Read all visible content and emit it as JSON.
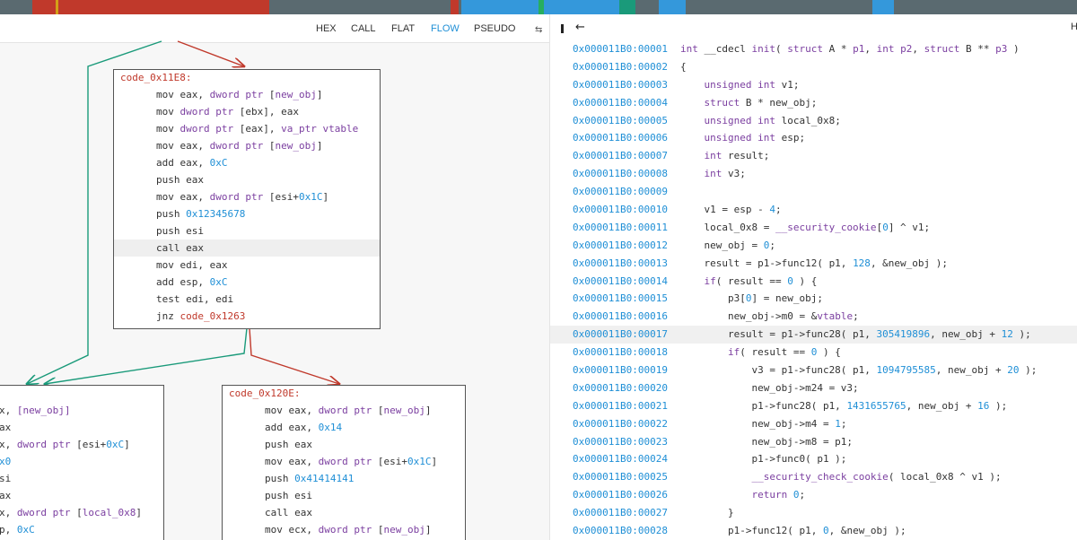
{
  "colors": {
    "accent": "#1f8fd6",
    "false_edge": "#c0392b",
    "true_edge": "#1a9a7a",
    "keyword": "#7b3fa0"
  },
  "navband": [
    {
      "color": "#c0392b",
      "start": 0.03,
      "end": 0.25
    },
    {
      "color": "#d4a017",
      "start": 0.052,
      "end": 0.054
    },
    {
      "color": "#c0392b",
      "start": 0.418,
      "end": 0.426
    },
    {
      "color": "#3498db",
      "start": 0.428,
      "end": 0.5
    },
    {
      "color": "#27ae60",
      "start": 0.5,
      "end": 0.505
    },
    {
      "color": "#3498db",
      "start": 0.505,
      "end": 0.575
    },
    {
      "color": "#1a9a7a",
      "start": 0.575,
      "end": 0.59
    },
    {
      "color": "#3498db",
      "start": 0.612,
      "end": 0.637
    },
    {
      "color": "#3498db",
      "start": 0.81,
      "end": 0.83
    }
  ],
  "tabs": [
    {
      "label": "HEX",
      "active": false
    },
    {
      "label": "CALL",
      "active": false
    },
    {
      "label": "FLAT",
      "active": false
    },
    {
      "label": "FLOW",
      "active": true
    },
    {
      "label": "PSEUDO",
      "active": false
    }
  ],
  "icons": {
    "swap": "swap-icon",
    "pin": "pin-icon",
    "back": "back-arrow-icon"
  },
  "right_toolbar": {
    "h_label": "H"
  },
  "nodes": {
    "main": {
      "title": "code_0x11E8:",
      "lines": [
        [
          [
            "kw",
            "mov eax, "
          ],
          [
            "pu",
            "dword ptr"
          ],
          [
            "kw",
            " ["
          ],
          [
            "pu",
            "new_obj"
          ],
          [
            "kw",
            "]"
          ]
        ],
        [
          [
            "kw",
            "mov "
          ],
          [
            "pu",
            "dword ptr"
          ],
          [
            "kw",
            " [ebx], eax"
          ]
        ],
        [
          [
            "kw",
            "mov "
          ],
          [
            "pu",
            "dword ptr"
          ],
          [
            "kw",
            " [eax], "
          ],
          [
            "pu",
            "va_ptr vtable"
          ]
        ],
        [
          [
            "kw",
            "mov eax, "
          ],
          [
            "pu",
            "dword ptr"
          ],
          [
            "kw",
            " ["
          ],
          [
            "pu",
            "new_obj"
          ],
          [
            "kw",
            "]"
          ]
        ],
        [
          [
            "kw",
            "add eax, "
          ],
          [
            "bl",
            "0xC"
          ]
        ],
        [
          [
            "kw",
            "push eax"
          ]
        ],
        [
          [
            "kw",
            "mov eax, "
          ],
          [
            "pu",
            "dword ptr"
          ],
          [
            "kw",
            " [esi+"
          ],
          [
            "bl",
            "0x1C"
          ],
          [
            "kw",
            "]"
          ]
        ],
        [
          [
            "kw",
            "push "
          ],
          [
            "bl",
            "0x12345678"
          ]
        ],
        [
          [
            "kw",
            "push esi"
          ]
        ],
        [
          [
            "kw",
            "call eax"
          ]
        ],
        [
          [
            "kw",
            "mov edi, eax"
          ]
        ],
        [
          [
            "kw",
            "add esp, "
          ],
          [
            "bl",
            "0xC"
          ]
        ],
        [
          [
            "kw",
            "test edi, edi"
          ]
        ],
        [
          [
            "kw",
            "jnz "
          ],
          [
            "rd",
            "code_0x1263"
          ]
        ]
      ]
    },
    "left": {
      "title": "",
      "lines": [
        [
          [
            "kw",
            "x, "
          ],
          [
            "pu",
            "[new_obj]"
          ]
        ],
        [
          [
            "kw",
            "ax"
          ]
        ],
        [
          [
            "kw",
            "x, "
          ],
          [
            "pu",
            "dword ptr"
          ],
          [
            "kw",
            " [esi+"
          ],
          [
            "bl",
            "0xC"
          ],
          [
            "kw",
            "]"
          ]
        ],
        [
          [
            "bl",
            "x0"
          ]
        ],
        [
          [
            "kw",
            "si"
          ]
        ],
        [
          [
            "kw",
            "ax"
          ]
        ],
        [
          [
            "kw",
            "x, "
          ],
          [
            "pu",
            "dword ptr"
          ],
          [
            "kw",
            " ["
          ],
          [
            "pu",
            "local_0x8"
          ],
          [
            "kw",
            "]"
          ]
        ],
        [
          [
            "kw",
            "p, "
          ],
          [
            "bl",
            "0xC"
          ]
        ]
      ]
    },
    "right": {
      "title": "code_0x120E:",
      "lines": [
        [
          [
            "kw",
            "mov eax, "
          ],
          [
            "pu",
            "dword ptr"
          ],
          [
            "kw",
            " ["
          ],
          [
            "pu",
            "new_obj"
          ],
          [
            "kw",
            "]"
          ]
        ],
        [
          [
            "kw",
            "add eax, "
          ],
          [
            "bl",
            "0x14"
          ]
        ],
        [
          [
            "kw",
            "push eax"
          ]
        ],
        [
          [
            "kw",
            "mov eax, "
          ],
          [
            "pu",
            "dword ptr"
          ],
          [
            "kw",
            " [esi+"
          ],
          [
            "bl",
            "0x1C"
          ],
          [
            "kw",
            "]"
          ]
        ],
        [
          [
            "kw",
            "push "
          ],
          [
            "bl",
            "0x41414141"
          ]
        ],
        [
          [
            "kw",
            "push esi"
          ]
        ],
        [
          [
            "kw",
            "call eax"
          ]
        ],
        [
          [
            "kw",
            "mov ecx, "
          ],
          [
            "pu",
            "dword ptr"
          ],
          [
            "kw",
            " ["
          ],
          [
            "pu",
            "new_obj"
          ],
          [
            "kw",
            "]"
          ]
        ]
      ]
    }
  },
  "pseudo": {
    "lines": [
      {
        "addr": "0x000011B0:00001",
        "code": [
          [
            "n",
            ""
          ],
          [
            "t",
            "int"
          ],
          [
            "x",
            " __cdecl "
          ],
          [
            "t",
            "init"
          ],
          [
            "x",
            "( "
          ],
          [
            "t",
            "struct"
          ],
          [
            "x",
            " A * "
          ],
          [
            "t",
            "p1"
          ],
          [
            "x",
            ", "
          ],
          [
            "t",
            "int"
          ],
          [
            "x",
            " "
          ],
          [
            "t",
            "p2"
          ],
          [
            "x",
            ", "
          ],
          [
            "t",
            "struct"
          ],
          [
            "x",
            " B ** "
          ],
          [
            "t",
            "p3"
          ],
          [
            "x",
            " )"
          ]
        ]
      },
      {
        "addr": "0x000011B0:00002",
        "code": [
          [
            "x",
            "{"
          ]
        ]
      },
      {
        "addr": "0x000011B0:00003",
        "code": [
          [
            "x",
            "    "
          ],
          [
            "t",
            "unsigned int"
          ],
          [
            "x",
            " v1;"
          ]
        ]
      },
      {
        "addr": "0x000011B0:00004",
        "code": [
          [
            "x",
            "    "
          ],
          [
            "t",
            "struct"
          ],
          [
            "x",
            " B * new_obj;"
          ]
        ]
      },
      {
        "addr": "0x000011B0:00005",
        "code": [
          [
            "x",
            "    "
          ],
          [
            "t",
            "unsigned int"
          ],
          [
            "x",
            " local_0x8;"
          ]
        ]
      },
      {
        "addr": "0x000011B0:00006",
        "code": [
          [
            "x",
            "    "
          ],
          [
            "t",
            "unsigned int"
          ],
          [
            "x",
            " esp;"
          ]
        ]
      },
      {
        "addr": "0x000011B0:00007",
        "code": [
          [
            "x",
            "    "
          ],
          [
            "t",
            "int"
          ],
          [
            "x",
            " result;"
          ]
        ]
      },
      {
        "addr": "0x000011B0:00008",
        "code": [
          [
            "x",
            "    "
          ],
          [
            "t",
            "int"
          ],
          [
            "x",
            " v3;"
          ]
        ]
      },
      {
        "addr": "0x000011B0:00009",
        "code": [
          [
            "x",
            ""
          ]
        ]
      },
      {
        "addr": "0x000011B0:00010",
        "code": [
          [
            "x",
            "    v1 = esp - "
          ],
          [
            "n",
            "4"
          ],
          [
            "x",
            ";"
          ]
        ]
      },
      {
        "addr": "0x000011B0:00011",
        "code": [
          [
            "x",
            "    local_0x8 = "
          ],
          [
            "t",
            "__security_cookie"
          ],
          [
            "x",
            "["
          ],
          [
            "n",
            "0"
          ],
          [
            "x",
            "] ^ v1;"
          ]
        ]
      },
      {
        "addr": "0x000011B0:00012",
        "code": [
          [
            "x",
            "    new_obj = "
          ],
          [
            "n",
            "0"
          ],
          [
            "x",
            ";"
          ]
        ]
      },
      {
        "addr": "0x000011B0:00013",
        "code": [
          [
            "x",
            "    result = p1->func12( p1, "
          ],
          [
            "n",
            "128"
          ],
          [
            "x",
            ", &new_obj );"
          ]
        ]
      },
      {
        "addr": "0x000011B0:00014",
        "code": [
          [
            "x",
            "    "
          ],
          [
            "t",
            "if"
          ],
          [
            "x",
            "( result == "
          ],
          [
            "n",
            "0"
          ],
          [
            "x",
            " ) {"
          ]
        ]
      },
      {
        "addr": "0x000011B0:00015",
        "code": [
          [
            "x",
            "        p3["
          ],
          [
            "n",
            "0"
          ],
          [
            "x",
            "] = new_obj;"
          ]
        ]
      },
      {
        "addr": "0x000011B0:00016",
        "code": [
          [
            "x",
            "        new_obj->m0 = &"
          ],
          [
            "t",
            "vtable"
          ],
          [
            "x",
            ";"
          ]
        ]
      },
      {
        "addr": "0x000011B0:00017",
        "code": [
          [
            "x",
            "        result = p1->func28( p1, "
          ],
          [
            "n",
            "305419896"
          ],
          [
            "x",
            ", new_obj + "
          ],
          [
            "n",
            "12"
          ],
          [
            "x",
            " );"
          ]
        ],
        "hl": true
      },
      {
        "addr": "0x000011B0:00018",
        "code": [
          [
            "x",
            "        "
          ],
          [
            "t",
            "if"
          ],
          [
            "x",
            "( result == "
          ],
          [
            "n",
            "0"
          ],
          [
            "x",
            " ) {"
          ]
        ]
      },
      {
        "addr": "0x000011B0:00019",
        "code": [
          [
            "x",
            "            v3 = p1->func28( p1, "
          ],
          [
            "n",
            "1094795585"
          ],
          [
            "x",
            ", new_obj + "
          ],
          [
            "n",
            "20"
          ],
          [
            "x",
            " );"
          ]
        ]
      },
      {
        "addr": "0x000011B0:00020",
        "code": [
          [
            "x",
            "            new_obj->m24 = v3;"
          ]
        ]
      },
      {
        "addr": "0x000011B0:00021",
        "code": [
          [
            "x",
            "            p1->func28( p1, "
          ],
          [
            "n",
            "1431655765"
          ],
          [
            "x",
            ", new_obj + "
          ],
          [
            "n",
            "16"
          ],
          [
            "x",
            " );"
          ]
        ]
      },
      {
        "addr": "0x000011B0:00022",
        "code": [
          [
            "x",
            "            new_obj->m4 = "
          ],
          [
            "n",
            "1"
          ],
          [
            "x",
            ";"
          ]
        ]
      },
      {
        "addr": "0x000011B0:00023",
        "code": [
          [
            "x",
            "            new_obj->m8 = p1;"
          ]
        ]
      },
      {
        "addr": "0x000011B0:00024",
        "code": [
          [
            "x",
            "            p1->func0( p1 );"
          ]
        ]
      },
      {
        "addr": "0x000011B0:00025",
        "code": [
          [
            "x",
            "            "
          ],
          [
            "t",
            "__security_check_cookie"
          ],
          [
            "x",
            "( local_0x8 ^ v1 );"
          ]
        ]
      },
      {
        "addr": "0x000011B0:00026",
        "code": [
          [
            "x",
            "            "
          ],
          [
            "t",
            "return"
          ],
          [
            "x",
            " "
          ],
          [
            "n",
            "0"
          ],
          [
            "x",
            ";"
          ]
        ]
      },
      {
        "addr": "0x000011B0:00027",
        "code": [
          [
            "x",
            "        }"
          ]
        ]
      },
      {
        "addr": "0x000011B0:00028",
        "code": [
          [
            "x",
            "        p1->func12( p1, "
          ],
          [
            "n",
            "0"
          ],
          [
            "x",
            ", &new_obj );"
          ]
        ]
      }
    ]
  }
}
